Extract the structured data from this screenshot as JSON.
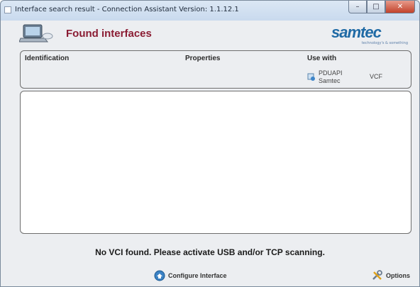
{
  "window": {
    "title": "Interface search result - Connection Assistant Version: 1.1.12.1",
    "minimize_label": "–",
    "maximize_label": "□",
    "close_label": "✕"
  },
  "header": {
    "title": "Found interfaces",
    "logo_text": "samtec",
    "logo_tagline": "technology's & something"
  },
  "columns": {
    "identification": "Identification",
    "properties": "Properties",
    "use_with": "Use with",
    "use_with_items": [
      "PDUAPI",
      "Samtec",
      "VCF"
    ]
  },
  "list": {
    "rows": []
  },
  "status": {
    "message": "No VCI found. Please activate USB and/or TCP scanning."
  },
  "footer": {
    "configure_label": "Configure Interface",
    "options_label": "Options"
  },
  "colors": {
    "title_accent": "#8a1c33",
    "logo_blue": "#1f6aa5",
    "close_red": "#c2422b"
  },
  "icons": [
    "laptop-icon",
    "samtec-logo",
    "pduapi-icon",
    "configure-icon",
    "options-icon"
  ]
}
